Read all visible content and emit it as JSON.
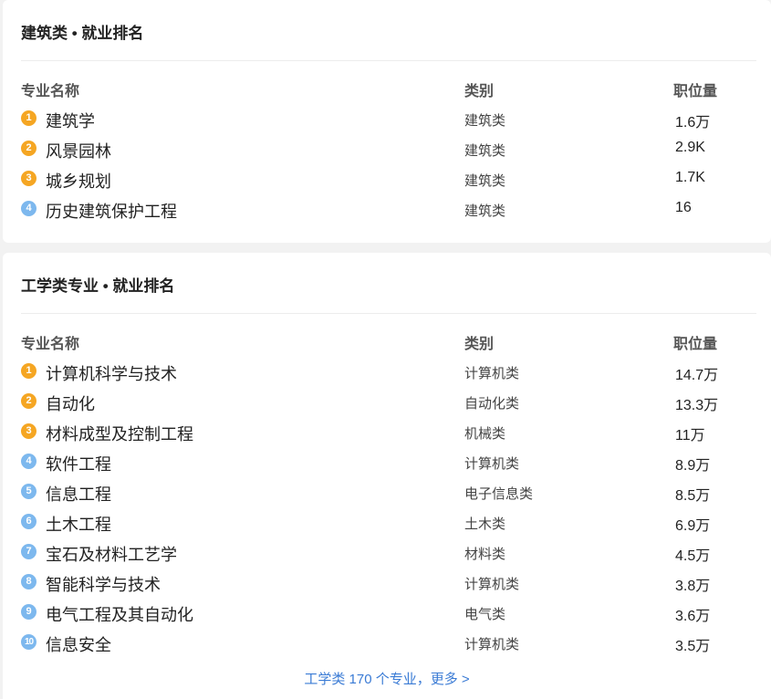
{
  "sections": [
    {
      "title": "建筑类 • 就业排名",
      "headers": {
        "name": "专业名称",
        "category": "类别",
        "jobs": "职位量"
      },
      "rows": [
        {
          "rank": "1",
          "name": "建筑学",
          "category": "建筑类",
          "jobs": "1.6万"
        },
        {
          "rank": "2",
          "name": "风景园林",
          "category": "建筑类",
          "jobs": "2.9K"
        },
        {
          "rank": "3",
          "name": "城乡规划",
          "category": "建筑类",
          "jobs": "1.7K"
        },
        {
          "rank": "4",
          "name": "历史建筑保护工程",
          "category": "建筑类",
          "jobs": "16"
        }
      ]
    },
    {
      "title": "工学类专业 • 就业排名",
      "headers": {
        "name": "专业名称",
        "category": "类别",
        "jobs": "职位量"
      },
      "rows": [
        {
          "rank": "1",
          "name": "计算机科学与技术",
          "category": "计算机类",
          "jobs": "14.7万"
        },
        {
          "rank": "2",
          "name": "自动化",
          "category": "自动化类",
          "jobs": "13.3万"
        },
        {
          "rank": "3",
          "name": "材料成型及控制工程",
          "category": "机械类",
          "jobs": "11万"
        },
        {
          "rank": "4",
          "name": "软件工程",
          "category": "计算机类",
          "jobs": "8.9万"
        },
        {
          "rank": "5",
          "name": "信息工程",
          "category": "电子信息类",
          "jobs": "8.5万"
        },
        {
          "rank": "6",
          "name": "土木工程",
          "category": "土木类",
          "jobs": "6.9万"
        },
        {
          "rank": "7",
          "name": "宝石及材料工艺学",
          "category": "材料类",
          "jobs": "4.5万"
        },
        {
          "rank": "8",
          "name": "智能科学与技术",
          "category": "计算机类",
          "jobs": "3.8万"
        },
        {
          "rank": "9",
          "name": "电气工程及其自动化",
          "category": "电气类",
          "jobs": "3.6万"
        },
        {
          "rank": "10",
          "name": "信息安全",
          "category": "计算机类",
          "jobs": "3.5万"
        }
      ],
      "more_link": "工学类 170 个专业，更多 >"
    }
  ],
  "colors": {
    "rank_top": "#f5a623",
    "rank_other": "#7db8ee",
    "link": "#3a7bd5"
  }
}
